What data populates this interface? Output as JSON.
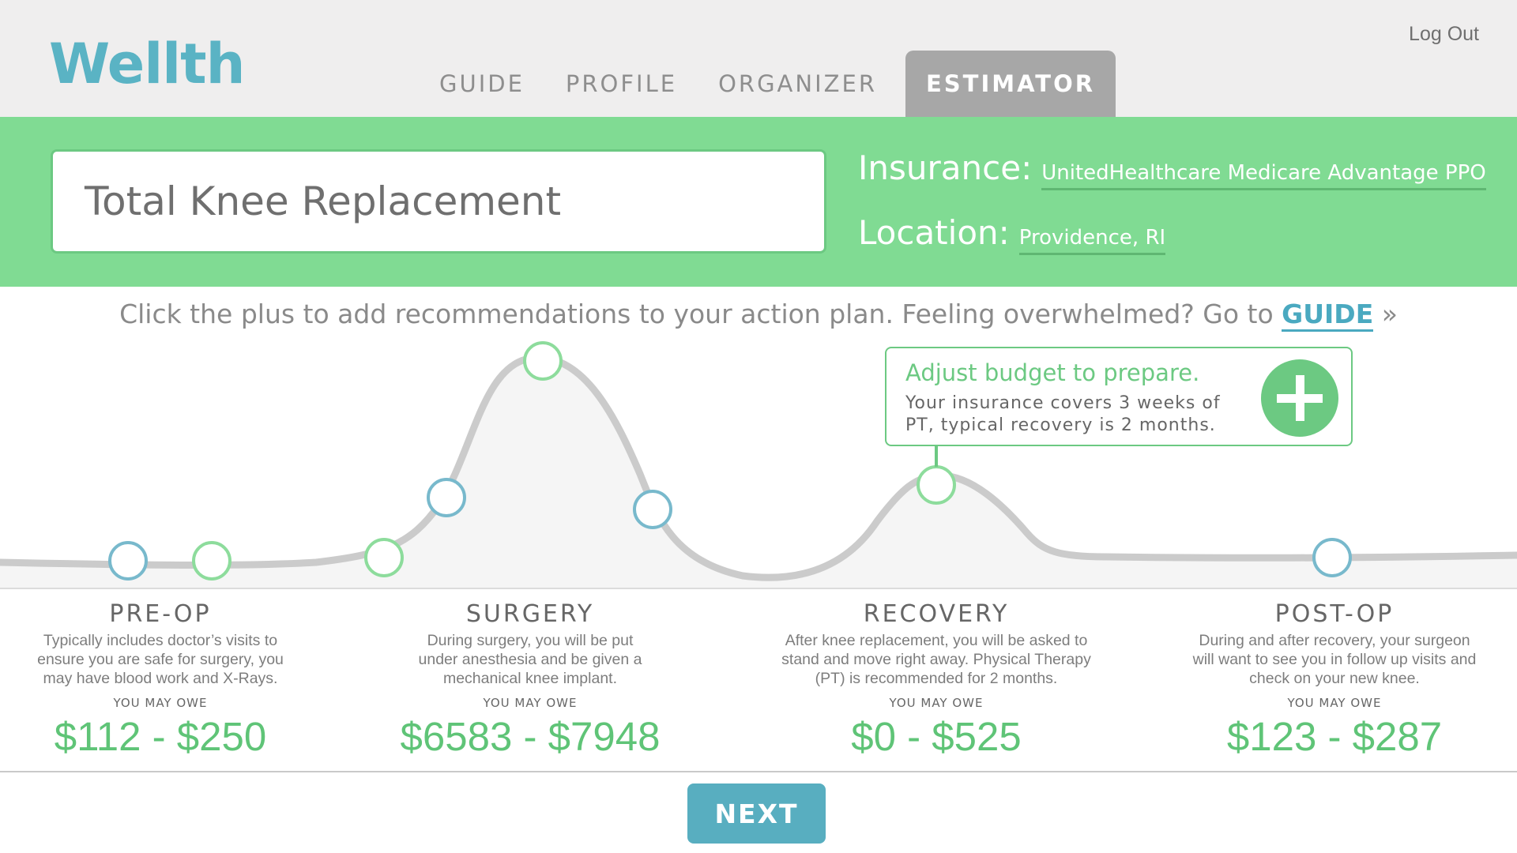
{
  "header": {
    "logo": "Wellth",
    "nav": [
      {
        "label": "GUIDE"
      },
      {
        "label": "PROFILE"
      },
      {
        "label": "ORGANIZER"
      },
      {
        "label": "ESTIMATOR",
        "active": true
      }
    ],
    "logout_label": "Log Out"
  },
  "band": {
    "procedure": "Total Knee Replacement",
    "insurance_label": "Insurance:",
    "insurance_value": "UnitedHealthcare Medicare Advantage PPO",
    "location_label": "Location:",
    "location_value": "Providence, RI"
  },
  "instruction": {
    "text": "Click the plus to add recommendations to your action plan. Feeling overwhelmed? Go to ",
    "link": "GUIDE",
    "suffix": " »"
  },
  "tooltip": {
    "title": "Adjust budget to prepare.",
    "body": "Your insurance covers 3 weeks of PT, typical recovery is 2 months.",
    "plus_icon": "plus-icon"
  },
  "timeline": {
    "line_color": "#cbcbcb",
    "blue_marker_color": "#78b9cc",
    "green_marker_color": "#8ddc9c"
  },
  "phases": [
    {
      "title": "PRE-OP",
      "description": "Typically includes doctor’s visits to ensure you are safe for surgery, you may have blood work and X-Rays.",
      "owe_label": "YOU MAY OWE",
      "cost": "$112 - $250"
    },
    {
      "title": "SURGERY",
      "description": "During surgery, you will be put under anesthesia and be given a mechanical knee implant.",
      "owe_label": "YOU MAY OWE",
      "cost": "$6583 - $7948"
    },
    {
      "title": "RECOVERY",
      "description": "After knee replacement, you will be asked to stand and move right away. Physical Therapy (PT) is recommended for 2 months.",
      "owe_label": "YOU MAY OWE",
      "cost": "$0 - $525"
    },
    {
      "title": "POST-OP",
      "description": "During and after recovery, your surgeon will want to see you in follow up visits and check on your new knee.",
      "owe_label": "YOU MAY OWE",
      "cost": "$123 - $287"
    }
  ],
  "next_label": "NEXT",
  "colors": {
    "accent_blue": "#5ab3c4",
    "accent_green": "#80db93",
    "cost_green": "#5fc477",
    "active_tab": "#a7a7a7"
  }
}
